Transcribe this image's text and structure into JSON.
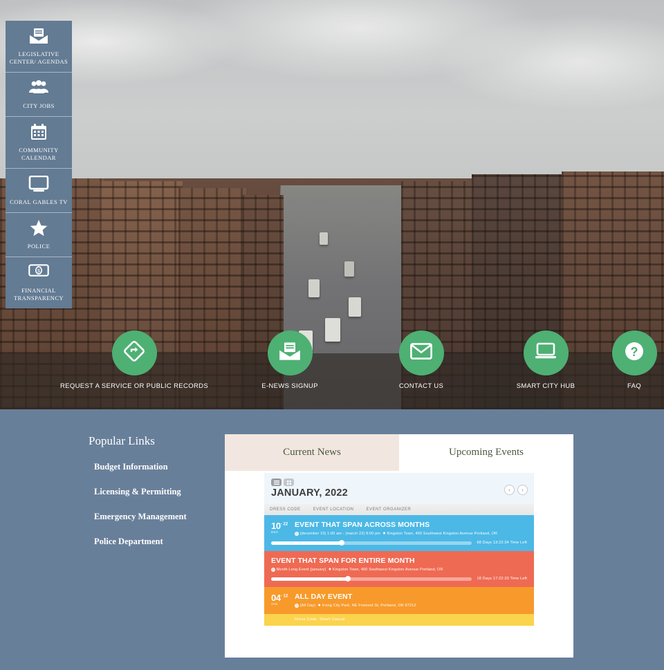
{
  "sidebar": {
    "items": [
      {
        "label": "LEGISLATIVE CENTER/ AGENDAS",
        "icon": "open-envelope-document-icon"
      },
      {
        "label": "CITY JOBS",
        "icon": "people-group-icon"
      },
      {
        "label": "COMMUNITY CALENDAR",
        "icon": "calendar-icon"
      },
      {
        "label": "CORAL GABLES TV",
        "icon": "monitor-tv-icon"
      },
      {
        "label": "POLICE",
        "icon": "star-badge-icon"
      },
      {
        "label": "FINANCIAL TRANSPARENCY",
        "icon": "dollar-bill-icon"
      }
    ]
  },
  "quick_links": {
    "items": [
      {
        "label": "REQUEST A SERVICE OR PUBLIC RECORDS",
        "icon": "direction-sign-icon"
      },
      {
        "label": "E-NEWS SIGNUP",
        "icon": "open-envelope-document-icon"
      },
      {
        "label": "CONTACT US",
        "icon": "envelope-icon"
      },
      {
        "label": "SMART CITY HUB",
        "icon": "laptop-icon"
      },
      {
        "label": "FAQ",
        "icon": "question-mark-icon"
      }
    ],
    "accent_color": "#4eb073"
  },
  "popular_links": {
    "title": "Popular Links",
    "items": [
      "Budget Information",
      "Licensing & Permitting",
      "Emergency Management",
      "Police Department"
    ]
  },
  "card": {
    "tabs": [
      {
        "label": "Current News",
        "active": true
      },
      {
        "label": "Upcoming Events",
        "active": false
      }
    ]
  },
  "calendar": {
    "month_title": "JANUARY, 2022",
    "prev_label": "‹",
    "next_label": "›",
    "view_toggles": [
      "list-view-toggle",
      "grid-view-toggle"
    ],
    "filters": [
      "DRESS CODE",
      "EVENT LOCATION",
      "EVENT ORGANIZER"
    ],
    "events": [
      {
        "color": "blue",
        "color_hex": "#4cb8e6",
        "day": "10",
        "day_sup": "- 22",
        "month": "DEC",
        "title": "EVENT THAT SPAN ACROSS MONTHS",
        "time": "(december 10) 1:00 am - (march 22) 8:00 pm",
        "location": "Kingston Town, 400 Southwest Kingston Avenue Portland, OR",
        "progress": 36,
        "time_left": "68 Days 13:22:34 Time Left",
        "footer": ""
      },
      {
        "color": "red",
        "color_hex": "#ef6a53",
        "day": "",
        "day_sup": "",
        "month": "",
        "title": "EVENT THAT SPAN FOR ENTIRE MONTH",
        "time": "Month Long Event (january)",
        "location": "Kingston Town, 400 Southwest Kingston Avenue Portland, OR",
        "progress": 39,
        "time_left": "18 Days 17:22:33 Time Left",
        "footer": ""
      },
      {
        "color": "orange",
        "color_hex": "#f79a2b",
        "day": "04",
        "day_sup": "- 12",
        "month": "JAN",
        "title": "ALL DAY EVENT",
        "time": "(All Day)",
        "location": "Irving City Park, NE Fremont St, Portland, OR 97212",
        "progress": 0,
        "time_left": "",
        "footer": "Dress Code:  Smart Casual"
      }
    ]
  },
  "theme": {
    "page_background": "#687f9a",
    "sidebar_background": "#637b93",
    "tab_active_background": "#f2e7e0"
  }
}
